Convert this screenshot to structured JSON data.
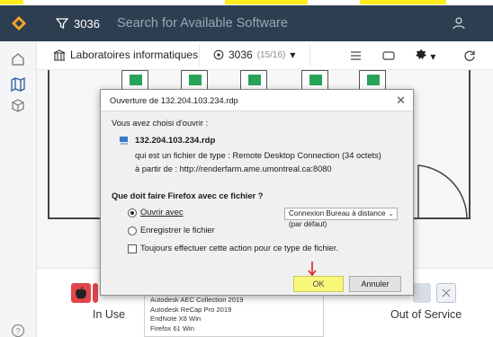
{
  "header": {
    "filter_label": "3036",
    "search_placeholder": "Search for Available Software"
  },
  "toolbar": {
    "building": "Laboratoires informatiques",
    "room": "3036",
    "room_count": "(15/16)"
  },
  "dialog": {
    "title": "Ouverture de 132.204.103.234.rdp",
    "intro": "Vous avez choisi d'ouvrir :",
    "filename": "132.204.103.234.rdp",
    "type_line": "qui est un fichier de type : Remote Desktop Connection (34 octets)",
    "from_line": "à partir de : http://renderfarm.ame.umontreal.ca:8080",
    "question": "Que doit faire Firefox avec ce fichier ?",
    "open_with_label": "Ouvrir avec",
    "open_with_value": "Connexion Bureau à distance (par défaut)",
    "save_label": "Enregistrer le fichier",
    "always_label": "Toujours effectuer cette action pour ce type de fichier.",
    "ok_label": "OK",
    "cancel_label": "Annuler"
  },
  "legend": {
    "in_use": "In Use",
    "out_of_service": "Out of Service",
    "partial_right": "f"
  },
  "applist": {
    "items": [
      "Autodesk AEC Collection 2019",
      "Autodesk ReCap Pro 2019",
      "EndNote X8 Win",
      "Firefox 61 Win"
    ]
  },
  "colors": {
    "header_bg": "#2d3e50",
    "highlight": "#ffee1a",
    "in_use": "#e0464a",
    "out_of_service": "#d7dde5",
    "available": "#27a35a"
  }
}
